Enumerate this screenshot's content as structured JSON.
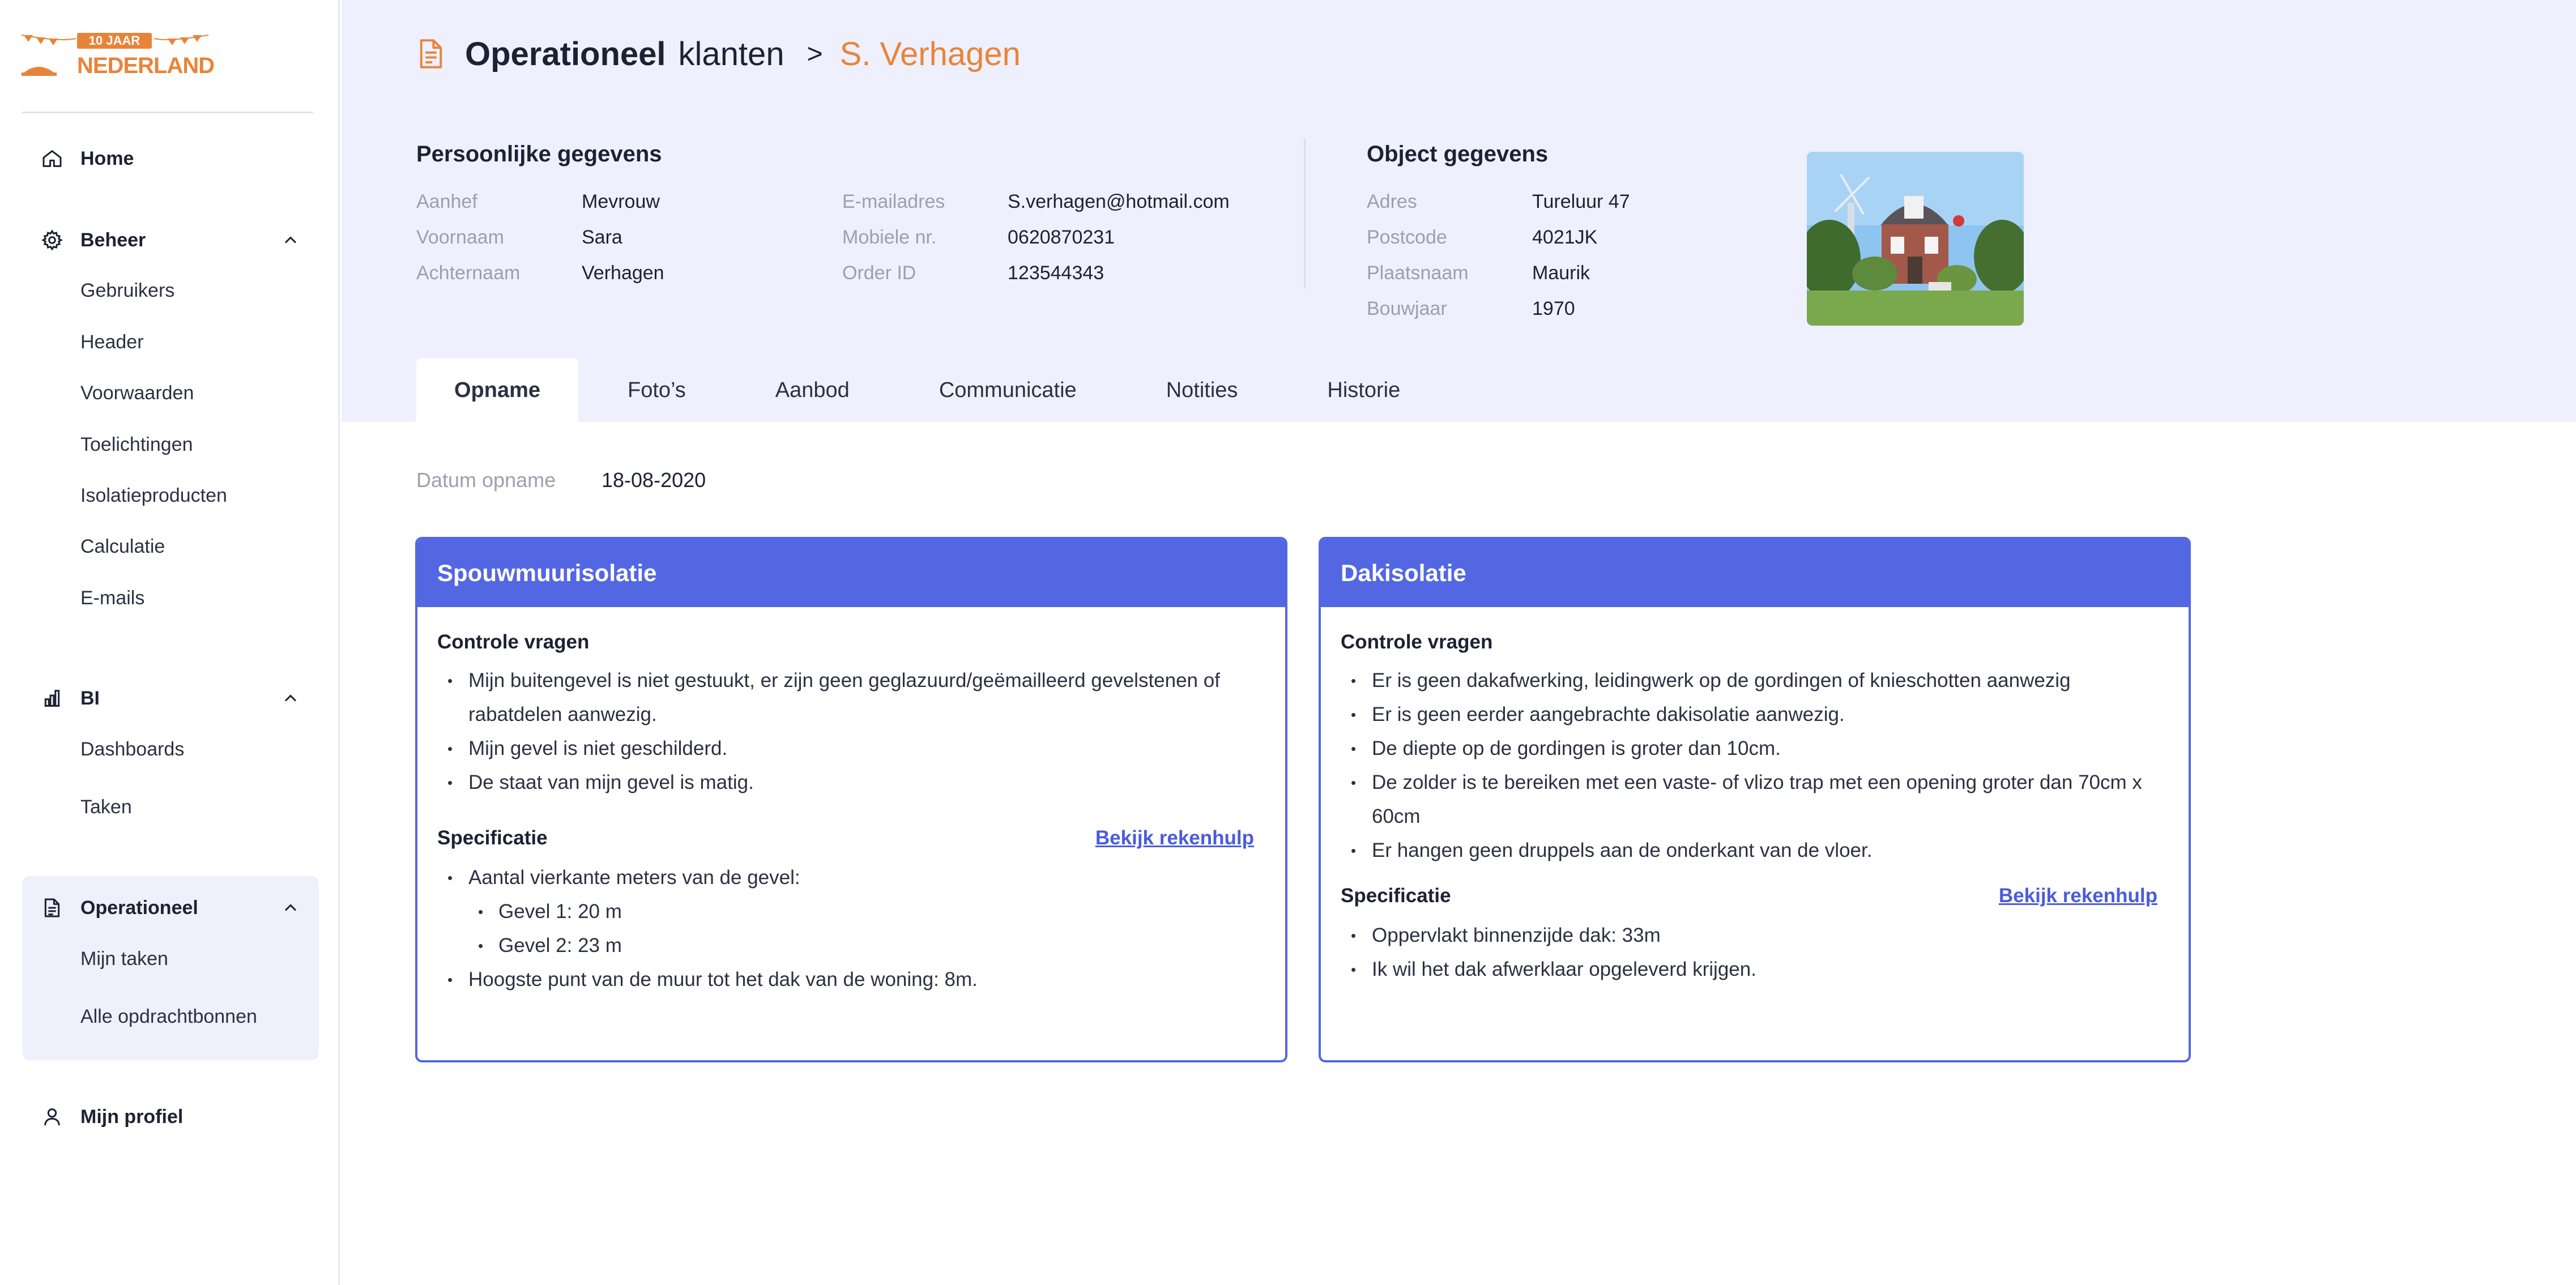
{
  "logo": {
    "badge": "10 JAAR",
    "name": "NEDERLAND"
  },
  "sidebar": {
    "home": "Home",
    "beheer": {
      "label": "Beheer",
      "items": [
        "Gebruikers",
        "Header",
        "Voorwaarden",
        "Toelichtingen",
        "Isolatieproducten",
        "Calculatie",
        "E-mails"
      ]
    },
    "bi": {
      "label": "BI",
      "items": [
        "Dashboards",
        "Taken"
      ]
    },
    "operationeel": {
      "label": "Operationeel",
      "items": [
        "Mijn taken",
        "Alle opdrachtbonnen"
      ]
    },
    "profile": "Mijn profiel"
  },
  "breadcrumb": {
    "part1": "Operationeel",
    "part2": "klanten",
    "separator": ">",
    "current": "S. Verhagen"
  },
  "personal": {
    "title": "Persoonlijke gegevens",
    "aanhef_label": "Aanhef",
    "aanhef": "Mevrouw",
    "voornaam_label": "Voornaam",
    "voornaam": "Sara",
    "achternaam_label": "Achternaam",
    "achternaam": "Verhagen",
    "email_label": "E-mailadres",
    "email": "S.verhagen@hotmail.com",
    "mobile_label": "Mobiele nr.",
    "mobile": "0620870231",
    "order_label": "Order ID",
    "order": "123544343"
  },
  "object": {
    "title": "Object gegevens",
    "adres_label": "Adres",
    "adres": "Tureluur 47",
    "postcode_label": "Postcode",
    "postcode": "4021JK",
    "plaats_label": "Plaatsnaam",
    "plaats": "Maurik",
    "bouwjaar_label": "Bouwjaar",
    "bouwjaar": "1970"
  },
  "tabs": [
    "Opname",
    "Foto’s",
    "Aanbod",
    "Communicatie",
    "Notities",
    "Historie"
  ],
  "opname": {
    "date_label": "Datum opname",
    "date": "18-08-2020"
  },
  "cards": [
    {
      "title": "Spouwmuurisolatie",
      "controle_title": "Controle vragen",
      "controle": [
        "Mijn buitengevel is niet gestuukt, er zijn geen geglazuurd/geëmailleerd gevelstenen  of rabatdelen aanwezig.",
        "Mijn gevel is niet geschilderd.",
        "De staat van mijn gevel is matig."
      ],
      "spec_title": "Specificatie",
      "link": "Bekijk rekenhulp",
      "spec": [
        "Aantal vierkante meters van de gevel:",
        "Gevel 1: 20 m",
        "Gevel 2: 23 m",
        "Hoogste punt van de muur tot het dak van de woning: 8m."
      ]
    },
    {
      "title": "Dakisolatie",
      "controle_title": "Controle vragen",
      "controle": [
        "Er is geen dakafwerking, leidingwerk op de gordingen of knieschotten aanwezig",
        "Er is geen eerder aangebrachte dakisolatie aanwezig.",
        "De diepte op de gordingen is groter dan 10cm.",
        "De zolder is te bereiken met een vaste- of vlizo trap met een opening groter dan 70cm x 60cm",
        "Er hangen geen druppels aan de onderkant van de vloer."
      ],
      "spec_title": "Specificatie",
      "link": "Bekijk rekenhulp",
      "spec": [
        "Oppervlakt binnenzijde dak: 33m",
        "Ik wil het dak afwerklaar opgeleverd krijgen."
      ]
    }
  ],
  "colors": {
    "accent": "#5467e3",
    "brand_orange": "#e8843a",
    "header_bg": "#eef0fd"
  }
}
